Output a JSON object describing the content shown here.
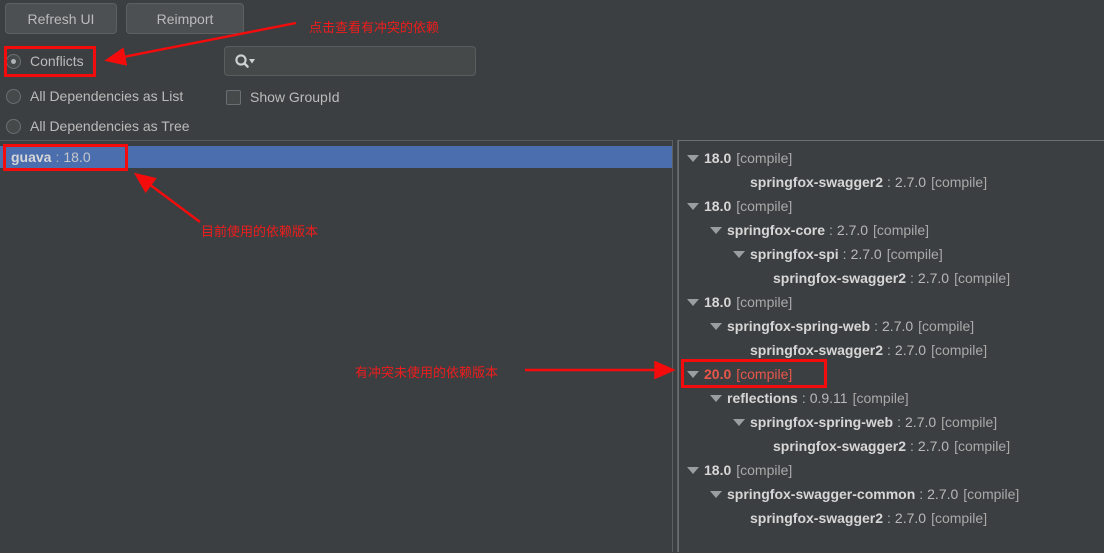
{
  "toolbar": {
    "refresh_label": "Refresh UI",
    "reimport_label": "Reimport",
    "search_placeholder": "",
    "search_value": "",
    "search_icon": "search-icon",
    "dropdown_icon": "chevron-down-icon",
    "show_groupid_label": "Show GroupId",
    "show_groupid_checked": false,
    "radios": [
      {
        "label": "Conflicts",
        "selected": true
      },
      {
        "label": "All Dependencies as List",
        "selected": false
      },
      {
        "label": "All Dependencies as Tree",
        "selected": false
      }
    ]
  },
  "left_panel": {
    "selected_item": {
      "artifact": "guava",
      "separator": ":",
      "version": "18.0"
    }
  },
  "right_panel": {
    "rows": [
      {
        "indent": 0,
        "twisty": true,
        "name": "18.0",
        "sep": "",
        "version": "",
        "scope": "[compile]",
        "conflict": false
      },
      {
        "indent": 2,
        "twisty": false,
        "name": "springfox-swagger2",
        "sep": ":",
        "version": "2.7.0",
        "scope": "[compile]",
        "conflict": false
      },
      {
        "indent": 0,
        "twisty": true,
        "name": "18.0",
        "sep": "",
        "version": "",
        "scope": "[compile]",
        "conflict": false
      },
      {
        "indent": 1,
        "twisty": true,
        "name": "springfox-core",
        "sep": ":",
        "version": "2.7.0",
        "scope": "[compile]",
        "conflict": false
      },
      {
        "indent": 2,
        "twisty": true,
        "name": "springfox-spi",
        "sep": ":",
        "version": "2.7.0",
        "scope": "[compile]",
        "conflict": false
      },
      {
        "indent": 3,
        "twisty": false,
        "name": "springfox-swagger2",
        "sep": ":",
        "version": "2.7.0",
        "scope": "[compile]",
        "conflict": false
      },
      {
        "indent": 0,
        "twisty": true,
        "name": "18.0",
        "sep": "",
        "version": "",
        "scope": "[compile]",
        "conflict": false
      },
      {
        "indent": 1,
        "twisty": true,
        "name": "springfox-spring-web",
        "sep": ":",
        "version": "2.7.0",
        "scope": "[compile]",
        "conflict": false
      },
      {
        "indent": 2,
        "twisty": false,
        "name": "springfox-swagger2",
        "sep": ":",
        "version": "2.7.0",
        "scope": "[compile]",
        "conflict": false
      },
      {
        "indent": 0,
        "twisty": true,
        "name": "20.0",
        "sep": "",
        "version": "",
        "scope": "[compile]",
        "conflict": true
      },
      {
        "indent": 1,
        "twisty": true,
        "name": "reflections",
        "sep": ":",
        "version": "0.9.11",
        "scope": "[compile]",
        "conflict": false
      },
      {
        "indent": 2,
        "twisty": true,
        "name": "springfox-spring-web",
        "sep": ":",
        "version": "2.7.0",
        "scope": "[compile]",
        "conflict": false
      },
      {
        "indent": 3,
        "twisty": false,
        "name": "springfox-swagger2",
        "sep": ":",
        "version": "2.7.0",
        "scope": "[compile]",
        "conflict": false
      },
      {
        "indent": 0,
        "twisty": true,
        "name": "18.0",
        "sep": "",
        "version": "",
        "scope": "[compile]",
        "conflict": false
      },
      {
        "indent": 1,
        "twisty": true,
        "name": "springfox-swagger-common",
        "sep": ":",
        "version": "2.7.0",
        "scope": "[compile]",
        "conflict": false
      },
      {
        "indent": 2,
        "twisty": false,
        "name": "springfox-swagger2",
        "sep": ":",
        "version": "2.7.0",
        "scope": "[compile]",
        "conflict": false
      }
    ]
  },
  "annotations": {
    "color": "#ee1c1c",
    "note_conflicts": "点击查看有冲突的依赖",
    "note_current_version": "目前使用的依赖版本",
    "note_conflict_unused": "有冲突未使用的依赖版本"
  },
  "colors": {
    "background": "#3c3f41",
    "selection": "#4b6eaf",
    "conflict_text": "#e8564a",
    "annotation_red": "#ee1c1c"
  }
}
